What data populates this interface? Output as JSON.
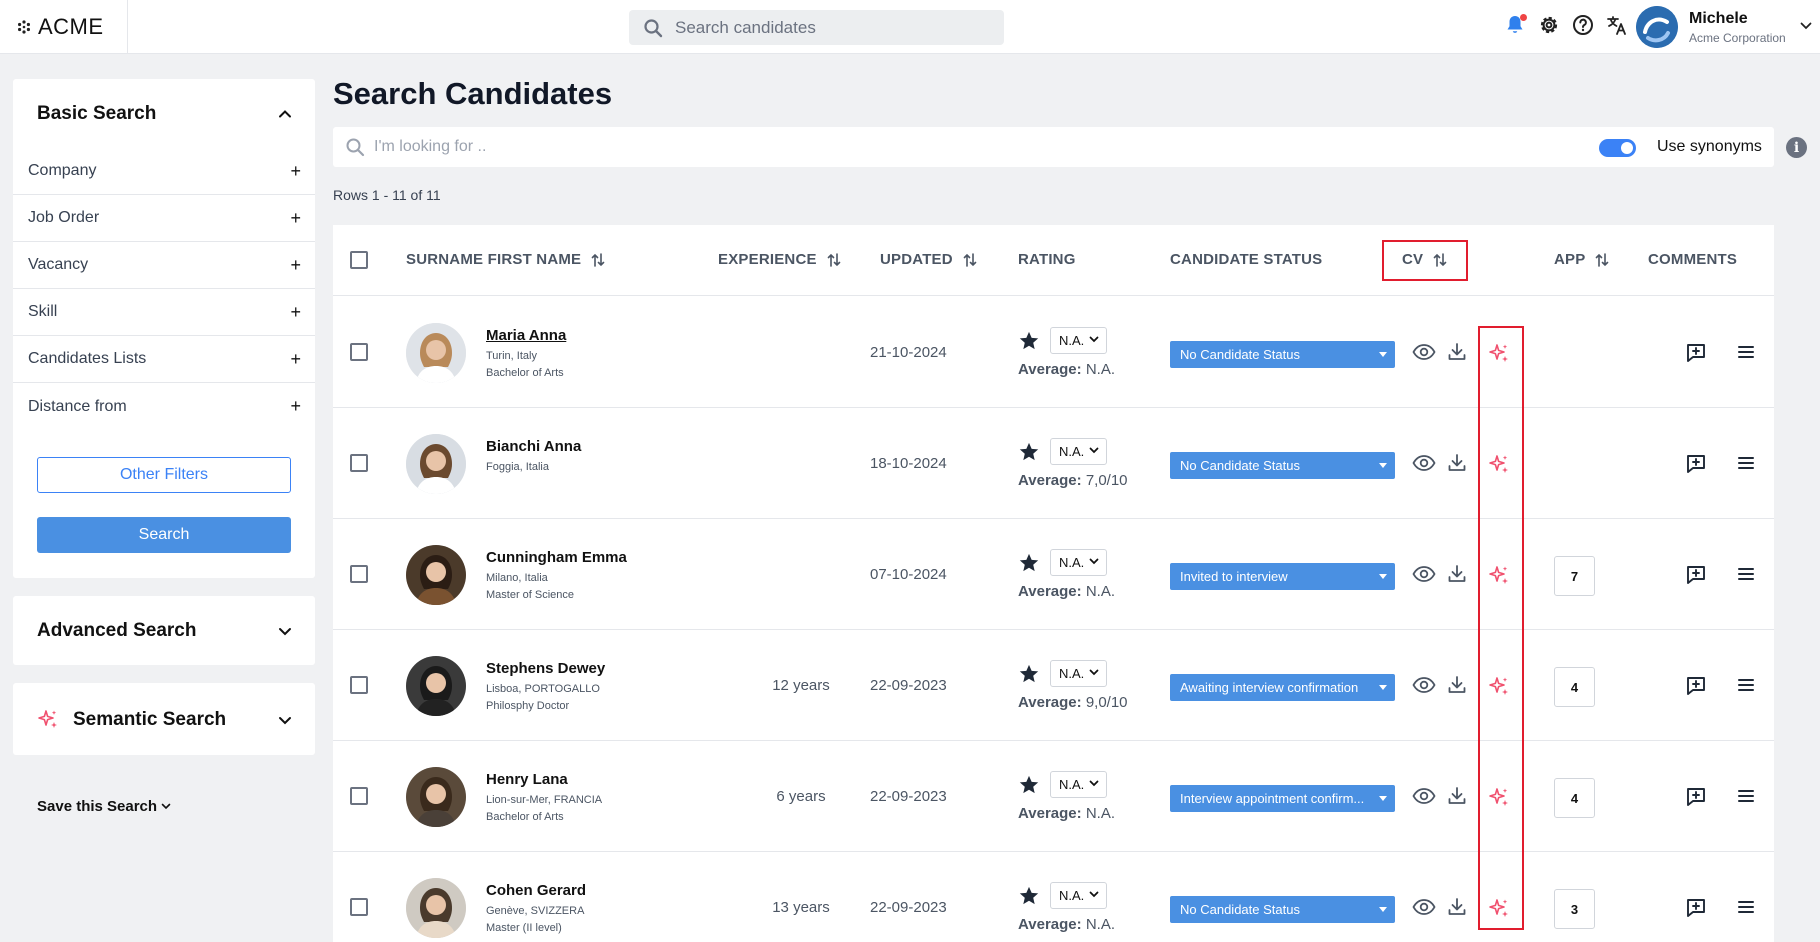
{
  "brand": {
    "name": "ACME"
  },
  "topbar": {
    "search_placeholder": "Search candidates",
    "user_name": "Michele",
    "user_company": "Acme Corporation"
  },
  "sidebar": {
    "basic_search_title": "Basic Search",
    "filters": [
      {
        "label": "Company"
      },
      {
        "label": "Job Order"
      },
      {
        "label": "Vacancy"
      },
      {
        "label": "Skill"
      },
      {
        "label": "Candidates Lists"
      },
      {
        "label": "Distance from"
      }
    ],
    "other_filters_label": "Other Filters",
    "search_label": "Search",
    "advanced_search_title": "Advanced Search",
    "semantic_search_title": "Semantic Search",
    "save_search_label": "Save this Search"
  },
  "main": {
    "title": "Search Candidates",
    "search_placeholder": "I'm looking for ..",
    "synonyms_label": "Use synonyms",
    "synonyms_on": true,
    "rows_count": "Rows 1 - 11 of 11"
  },
  "table": {
    "headers": {
      "name": "SURNAME FIRST NAME",
      "experience": "EXPERIENCE",
      "updated": "UPDATED",
      "rating": "RATING",
      "status": "CANDIDATE STATUS",
      "cv": "CV",
      "app": "APP",
      "comments": "COMMENTS"
    },
    "average_label": "Average:",
    "rows": [
      {
        "name": "Maria Anna",
        "location": "Turin, Italy",
        "degree": "Bachelor of Arts",
        "experience": "",
        "updated": "21-10-2024",
        "rating": "N.A.",
        "average": "N.A.",
        "status": "No Candidate Status",
        "app": "",
        "underlined": true
      },
      {
        "name": "Bianchi Anna",
        "location": "Foggia, Italia",
        "degree": "",
        "experience": "",
        "updated": "18-10-2024",
        "rating": "N.A.",
        "average": "7,0/10",
        "status": "No Candidate Status",
        "app": ""
      },
      {
        "name": "Cunningham Emma",
        "location": "Milano, Italia",
        "degree": "Master of Science",
        "experience": "",
        "updated": "07-10-2024",
        "rating": "N.A.",
        "average": "N.A.",
        "status": "Invited to interview",
        "app": "7"
      },
      {
        "name": "Stephens Dewey",
        "location": "Lisboa, PORTOGALLO",
        "degree": "Philosphy Doctor",
        "experience": "12 years",
        "updated": "22-09-2023",
        "rating": "N.A.",
        "average": "9,0/10",
        "status": "Awaiting interview confirmation",
        "app": "4"
      },
      {
        "name": "Henry Lana",
        "location": "Lion-sur-Mer, FRANCIA",
        "degree": "Bachelor of Arts",
        "experience": "6 years",
        "updated": "22-09-2023",
        "rating": "N.A.",
        "average": "N.A.",
        "status": "Interview appointment confirm...",
        "app": "4"
      },
      {
        "name": "Cohen Gerard",
        "location": "Genève, SVIZZERA",
        "degree": "Master (II level)",
        "experience": "13 years",
        "updated": "22-09-2023",
        "rating": "N.A.",
        "average": "N.A.",
        "status": "No Candidate Status",
        "app": "3"
      }
    ]
  },
  "colors": {
    "accent": "#4a90e2",
    "highlight": "#e11d2e",
    "sparkle": "#f0506e"
  },
  "icons": [
    "search-icon",
    "bell-icon",
    "gear-icon",
    "help-icon",
    "translate-icon",
    "sort-icon",
    "star-icon",
    "eye-icon",
    "download-icon",
    "sparkle-icon",
    "add-comment-icon",
    "menu-icon",
    "chevron-up-icon",
    "chevron-down-icon",
    "plus-icon",
    "info-icon"
  ]
}
